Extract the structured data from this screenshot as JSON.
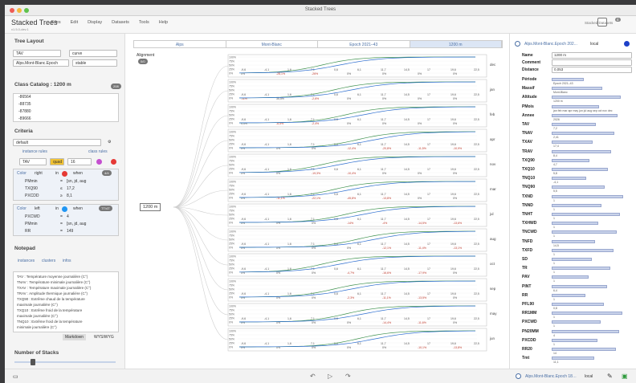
{
  "window": {
    "title": "Stacked Trees"
  },
  "app": {
    "name": "Stacked Trees",
    "version": "v1.5.0-dev.1"
  },
  "menu": [
    "Files",
    "Edit",
    "Display",
    "Datasets",
    "Tools",
    "Help"
  ],
  "toolbar": {
    "stacked_datasets_label": "Stacked Datasets",
    "stacked_count": "4"
  },
  "tree_layout": {
    "title": "Tree Layout",
    "tav": "TAV",
    "curve": "curve",
    "dataset": "Alps.Mont-Blanc.Epoch",
    "stable": "stable"
  },
  "catalog": {
    "title": "Class Catalog : 1200 m",
    "badge": "208",
    "items": [
      "-86564",
      "-88735",
      "-87880",
      "-89666"
    ]
  },
  "criteria": {
    "title": "Criteria",
    "preset": "default",
    "instance_rules": "instance rules",
    "class_rules": "class rules",
    "tav_row": {
      "attr": "TAV",
      "op": "quad",
      "val": "16"
    },
    "rule1": {
      "label": "Color",
      "side": "right",
      "in": "in",
      "when": "when",
      "badge": "4/4",
      "lines": [
        [
          "PMmin",
          "=",
          "[sn, jd, aug"
        ],
        [
          "TXQ90",
          "≤",
          "17,2"
        ],
        [
          "PXCDD",
          "≥",
          "8,1"
        ]
      ]
    },
    "rule2": {
      "label": "Color",
      "side": "left",
      "in": "in",
      "when": "when",
      "badge": "TT/4T",
      "lines": [
        [
          "PXCWD",
          "=",
          "4"
        ],
        [
          "PMmin",
          "=",
          "[sn, jd, aug"
        ],
        [
          "RR",
          "=",
          "149"
        ]
      ]
    }
  },
  "notepad": {
    "title": "Notepad",
    "tabs": [
      "instances",
      "clusters",
      "infos"
    ],
    "lines": [
      "TAV : Température moyenne journalière (C°)",
      "TNAV : Température minimale journalière (C°)",
      "TXAV : Température maximale journalière (C°)",
      "TRAV : Amplitude thermique journalière (C°)",
      "TXQ90 : Extrême chaud de la température",
      "maximale journalière (C°)",
      "TXQ10 : Extrême froid de la température",
      "maximale journalière (C°)",
      "TNQ10 : Extrême froid de la température",
      "minimale journalière (C°)"
    ],
    "btn1": "Markdown",
    "btn2": "WYSIWYG"
  },
  "stacks": {
    "title": "Number of Stacks",
    "min": "1",
    "max": "228"
  },
  "breadcrumb": [
    "Alps",
    "Mont-Blanc",
    "Epoch 2021–43",
    "1200 m"
  ],
  "alignment": {
    "label": "Alignment",
    "value": "0/0"
  },
  "root_node": "1200 m",
  "plot": {
    "yticks": [
      "100%",
      "75%",
      "50%",
      "25%",
      "0%"
    ],
    "xticks": [
      "-9,6",
      "-4,1",
      "1,6",
      "7,1",
      "0,6",
      "6,1",
      "11,7",
      "14,5",
      "17",
      "19,6",
      "22,5"
    ],
    "months": [
      "dec",
      "jan",
      "feb",
      "apr",
      "nov",
      "mar",
      "jul",
      "aug",
      "oct",
      "sep",
      "may",
      "jun"
    ],
    "pcts": [
      [
        "0%",
        "-28,1%",
        "-26%",
        "0%",
        "0%",
        "0%",
        "0%"
      ],
      [
        "-11%",
        "35,5%",
        "-2,6%",
        "0%",
        "0%",
        "0%",
        "0%"
      ],
      [
        "0,4%",
        "-8,5%",
        "-2,4%",
        "0%",
        "0%",
        "0%",
        "0%"
      ],
      [
        "0%",
        "0%",
        "0%",
        "-12,4%",
        "-20,8%",
        "-11,5%",
        "-10,9%"
      ],
      [
        "0%",
        "0%",
        "-19,3%",
        "-10,4%",
        "0%",
        "0%",
        "0%"
      ],
      [
        "0%",
        "-11,1%",
        "-22,1%",
        "-45,8%",
        "-13,8%",
        "0%",
        "0%"
      ],
      [
        "0%",
        "0%",
        "0%",
        "-14%",
        "-4%",
        "-14,5%",
        "-13,6%"
      ],
      [
        "0%",
        "0%",
        "0%",
        "0%",
        "-12,1%",
        "-11,4%",
        "-13,1%"
      ],
      [
        "0%",
        "0%",
        "0%",
        "-4,7%",
        "-16,6%",
        "-17,9%",
        "0%"
      ],
      [
        "0%",
        "0%",
        "0%",
        "-2,3%",
        "-11,1%",
        "-13,5%",
        "0%"
      ],
      [
        "0%",
        "0%",
        "0%",
        "0%",
        "-14,4%",
        "-11,6%",
        "0%"
      ],
      [
        "0%",
        "0%",
        "0%",
        "0%",
        "0%",
        "-10,1%",
        "-13,8%"
      ]
    ]
  },
  "inspector": {
    "title": "Alps.Mont-Blanc.Epoch 202...",
    "mode": "local",
    "fields": [
      [
        "Name",
        "1200 m"
      ],
      [
        "Comment",
        ""
      ],
      [
        "Distance",
        "0,053"
      ]
    ],
    "rows": [
      [
        "Période",
        "Epoch 2021–43"
      ],
      [
        "Massif",
        "Mont-Blanc"
      ],
      [
        "Altitude",
        "1200 m"
      ],
      [
        "PMois",
        "jan feb mar apr may jun jul aug sep oct nov dec"
      ],
      [
        "Annee",
        "2026"
      ],
      [
        "TAV",
        "7,2"
      ],
      [
        "TNAV",
        "2,41"
      ],
      [
        "TXAV",
        "17,4"
      ],
      [
        "TRAV",
        "8,4"
      ],
      [
        "TXQ90",
        "4,7"
      ],
      [
        "TXQ10",
        "5,8"
      ],
      [
        "TNQ10",
        "-4,1"
      ],
      [
        "TNQ90",
        "5,5"
      ],
      [
        "TXND",
        "1"
      ],
      [
        "TNND",
        "1"
      ],
      [
        "TNHT",
        "1"
      ],
      [
        "TXHWD",
        "1"
      ],
      [
        "TNCWD",
        "1"
      ],
      [
        "TNFD",
        "14,5"
      ],
      [
        "TXFD",
        "1"
      ],
      [
        "SD",
        "1"
      ],
      [
        "TR",
        "1"
      ],
      [
        "PAV",
        "1"
      ],
      [
        "PINT",
        "6,4"
      ],
      [
        "RR",
        "1"
      ],
      [
        "PFL90",
        "0,8"
      ],
      [
        "RR1MM",
        "1"
      ],
      [
        "PXCWD",
        "1"
      ],
      [
        "PN20MM",
        "4"
      ],
      [
        "PXCDD",
        "1"
      ],
      [
        "RR20",
        "14"
      ],
      [
        "Tmt",
        "11,1"
      ]
    ]
  },
  "bottombar": {
    "dataset": "Alps.Mont-Blanc.Epoch 18…",
    "mode": "local"
  }
}
